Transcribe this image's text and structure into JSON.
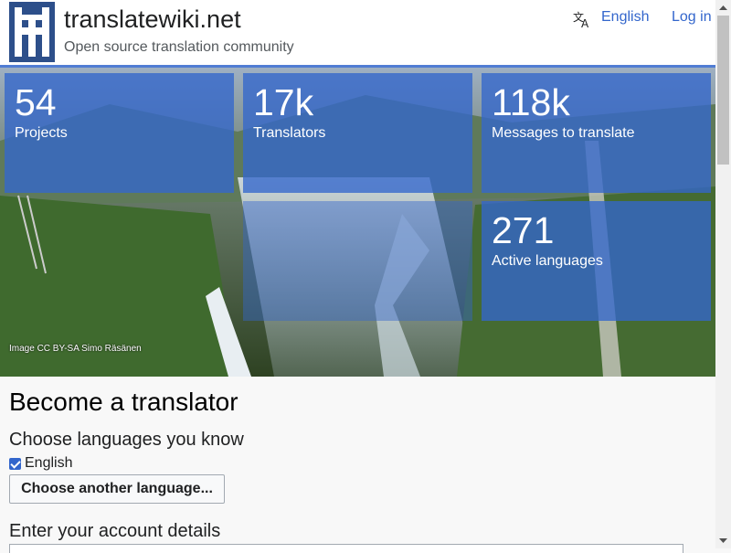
{
  "header": {
    "site_title": "translatewiki.net",
    "tagline": "Open source translation community",
    "language_label": "English",
    "login_label": "Log in",
    "icons": {
      "logo": "translatewiki-logo",
      "language": "translate-icon"
    }
  },
  "hero": {
    "stats": [
      {
        "value": "54",
        "label": "Projects"
      },
      {
        "value": "17k",
        "label": "Translators"
      },
      {
        "value": "118k",
        "label": "Messages to translate"
      },
      {
        "value": "271",
        "label": "Active languages"
      }
    ],
    "image_credit": "Image CC BY-SA Simo Räsänen"
  },
  "form": {
    "title": "Become a translator",
    "languages_heading": "Choose languages you know",
    "selected_language": "English",
    "selected_language_checked": true,
    "choose_button": "Choose another language...",
    "account_heading": "Enter your account details"
  },
  "colors": {
    "accent": "#3366cc",
    "tile": "#3366cc",
    "text": "#202122"
  }
}
